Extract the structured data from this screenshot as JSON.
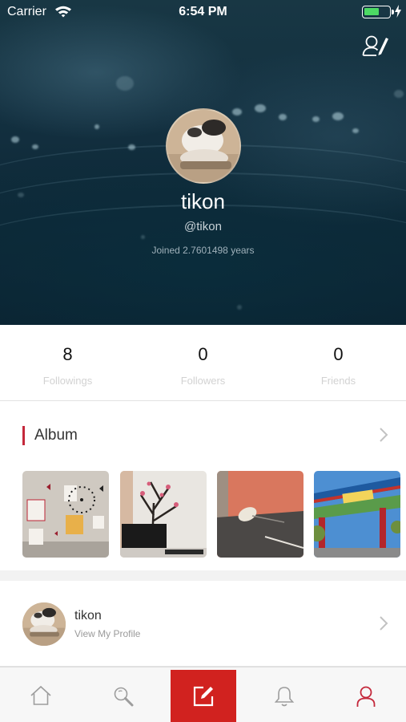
{
  "status_bar": {
    "carrier": "Carrier",
    "time": "6:54 PM"
  },
  "profile": {
    "name": "tikon",
    "handle": "@tikon",
    "joined": "Joined 2.7601498 years"
  },
  "stats": [
    {
      "value": "8",
      "label": "Followings"
    },
    {
      "value": "0",
      "label": "Followers"
    },
    {
      "value": "0",
      "label": "Friends"
    }
  ],
  "album": {
    "title": "Album"
  },
  "profile_row": {
    "name": "tikon",
    "subtitle": "View My Profile"
  },
  "tabbar": {
    "items": [
      "home-icon",
      "search-icon",
      "compose-icon",
      "bell-icon",
      "user-icon"
    ],
    "accent": "#d1221f"
  },
  "colors": {
    "accent_red": "#c4283b",
    "battery_green": "#4cd964"
  },
  "icons": {
    "edit_profile": "user-edit-icon",
    "chevron": "chevron-right-icon"
  }
}
